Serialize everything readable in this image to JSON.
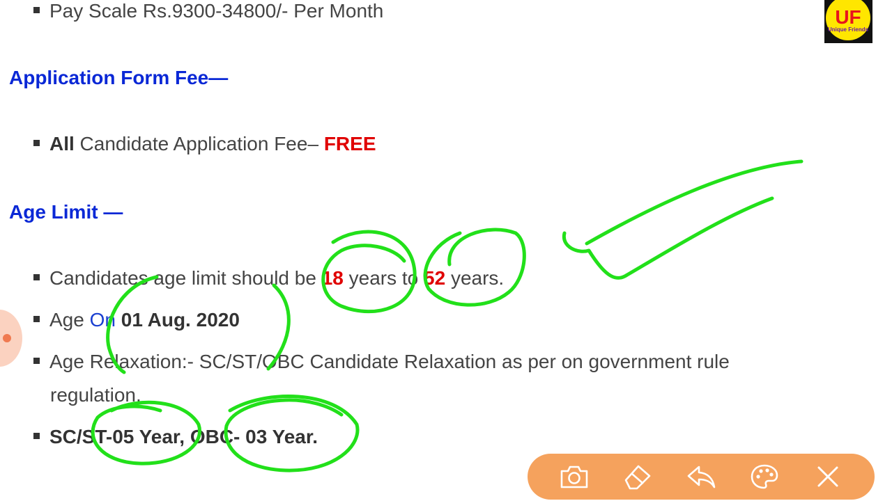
{
  "content": {
    "pay_scale": "Pay Scale Rs.9300-34800/- Per Month",
    "fee_heading": "Application Form Fee—",
    "fee_line": {
      "all": "All",
      "text": " Candidate Application Fee– ",
      "free": "FREE"
    },
    "age_heading": "Age Limit —",
    "age_line": {
      "prefix": "Candidates age limit should be ",
      "min": "18",
      "mid": " years to ",
      "max": "52",
      "suffix": " years."
    },
    "age_on": {
      "prefix": "Age ",
      "on": "On",
      "date": " 01 Aug. 2020"
    },
    "relaxation": {
      "line1": "Age Relaxation:- SC/ST/OBC Candidate Relaxation as per on government rule",
      "line2": "regulation."
    },
    "relaxation_years": "SC/ST-05 Year, OBC- 03 Year."
  },
  "logo": {
    "initials": "UF",
    "subtitle": "Unique Friends"
  },
  "toolbar": {
    "tools": [
      "camera-icon",
      "eraser-icon",
      "undo-icon",
      "palette-icon",
      "close-icon"
    ],
    "color": "#f5a25d"
  },
  "colors": {
    "heading": "#0a28d6",
    "highlight": "#e00000",
    "ink": "#22e01a"
  }
}
